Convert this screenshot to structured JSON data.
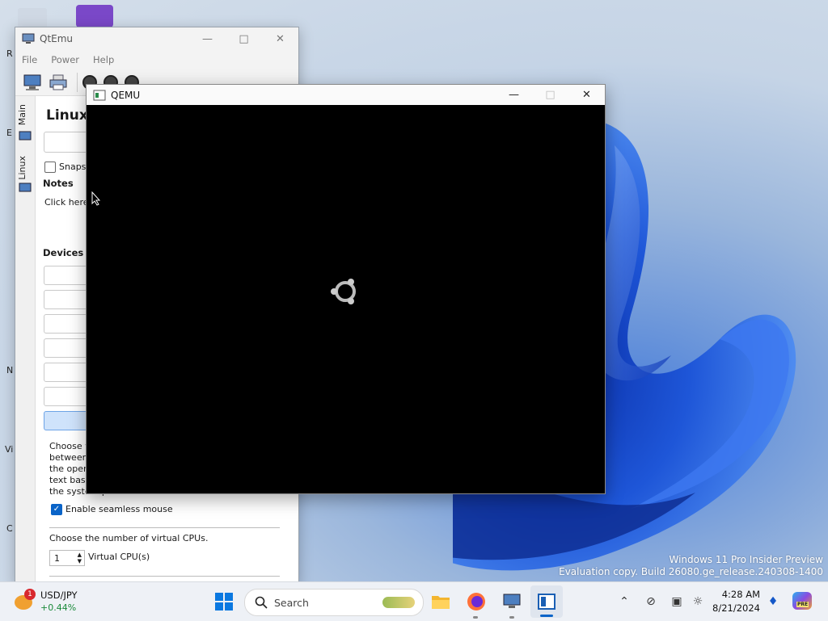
{
  "colors": {
    "accent": "#0a64c8",
    "taskbar_bg": "#eef1f6",
    "wallpaper_blue": "#1e56d8"
  },
  "desktop": {
    "icons": [
      "R",
      "E",
      "N",
      "Vi",
      "C"
    ],
    "watermark": {
      "line1": "Windows 11 Pro Insider Preview",
      "line2": "Evaluation copy. Build 26080.ge_release.240308-1400"
    }
  },
  "qtemu": {
    "title": "QtEmu",
    "menu": [
      "File",
      "Power",
      "Help"
    ],
    "toolbar_icons": [
      "machine-icon",
      "printer-icon",
      "power-icon",
      "stop-icon",
      "pause-icon"
    ],
    "tabs": [
      "Main",
      "Linux"
    ],
    "machine_name": "Linux",
    "snapshot_label": "Snapsh",
    "notes_heading": "Notes",
    "notes_placeholder": "Click here t",
    "devices_heading": "Devices",
    "mouse_desc_lines": [
      "Choose w",
      "between",
      "the opera",
      "text base",
      "the system performance."
    ],
    "seamless_mouse_label": "Enable seamless mouse",
    "cpu_prompt": "Choose the number of virtual CPUs.",
    "cpu_value": "1",
    "cpu_unit": "Virtual CPU(s)"
  },
  "qemu": {
    "title": "QEMU",
    "screen_icon": "ubuntu-loading-icon"
  },
  "taskbar": {
    "widget": {
      "badge": "1",
      "symbol": "USD/JPY",
      "change": "+0.44%"
    },
    "search_placeholder": "Search",
    "pinned": [
      "start-icon",
      "file-explorer-icon",
      "firefox-icon",
      "qtemu-icon",
      "qemu-icon"
    ],
    "tray_icons": [
      "chevron-up-icon",
      "network-off-icon",
      "display-icon",
      "accessibility-icon"
    ],
    "time": "4:28 AM",
    "date": "8/21/2024",
    "copilot_label": "PRE"
  }
}
